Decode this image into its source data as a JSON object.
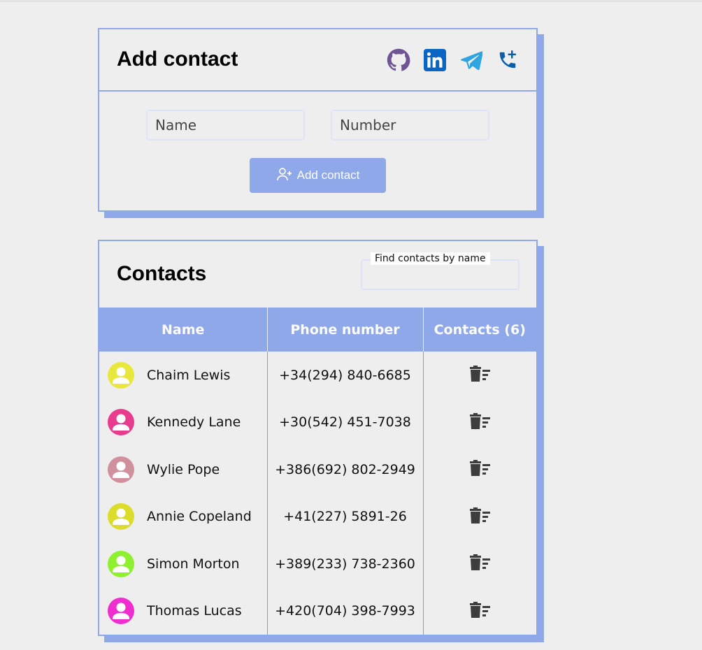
{
  "add_card": {
    "title": "Add contact",
    "name_placeholder": "Name",
    "number_placeholder": "Number",
    "add_button_label": "Add contact",
    "social_icons": [
      "github-icon",
      "linkedin-icon",
      "telegram-icon",
      "phone-add-icon"
    ]
  },
  "contacts_card": {
    "title": "Contacts",
    "search_label": "Find contacts by name",
    "search_value": ""
  },
  "table": {
    "headers": [
      "Name",
      "Phone number",
      "Contacts (6)"
    ],
    "rows": [
      {
        "name": "Chaim Lewis",
        "phone": "+34(294) 840-6685",
        "avatar_color": "#e8e83c"
      },
      {
        "name": "Kennedy Lane",
        "phone": "+30(542) 451-7038",
        "avatar_color": "#e83c8e"
      },
      {
        "name": "Wylie Pope",
        "phone": "+386(692) 802-2949",
        "avatar_color": "#d0909e"
      },
      {
        "name": "Annie Copeland",
        "phone": "+41(227) 5891-26",
        "avatar_color": "#dcdc2a"
      },
      {
        "name": "Simon Morton",
        "phone": "+389(233) 738-2360",
        "avatar_color": "#8ef02e"
      },
      {
        "name": "Thomas Lucas",
        "phone": "+420(704) 398-7993",
        "avatar_color": "#f02ecf"
      }
    ]
  },
  "colors": {
    "accent": "#8fa8e9",
    "github": "#6e5494",
    "linkedin": "#0a66c2",
    "telegram": "#2ca5e0",
    "phone": "#0a5fa8"
  }
}
